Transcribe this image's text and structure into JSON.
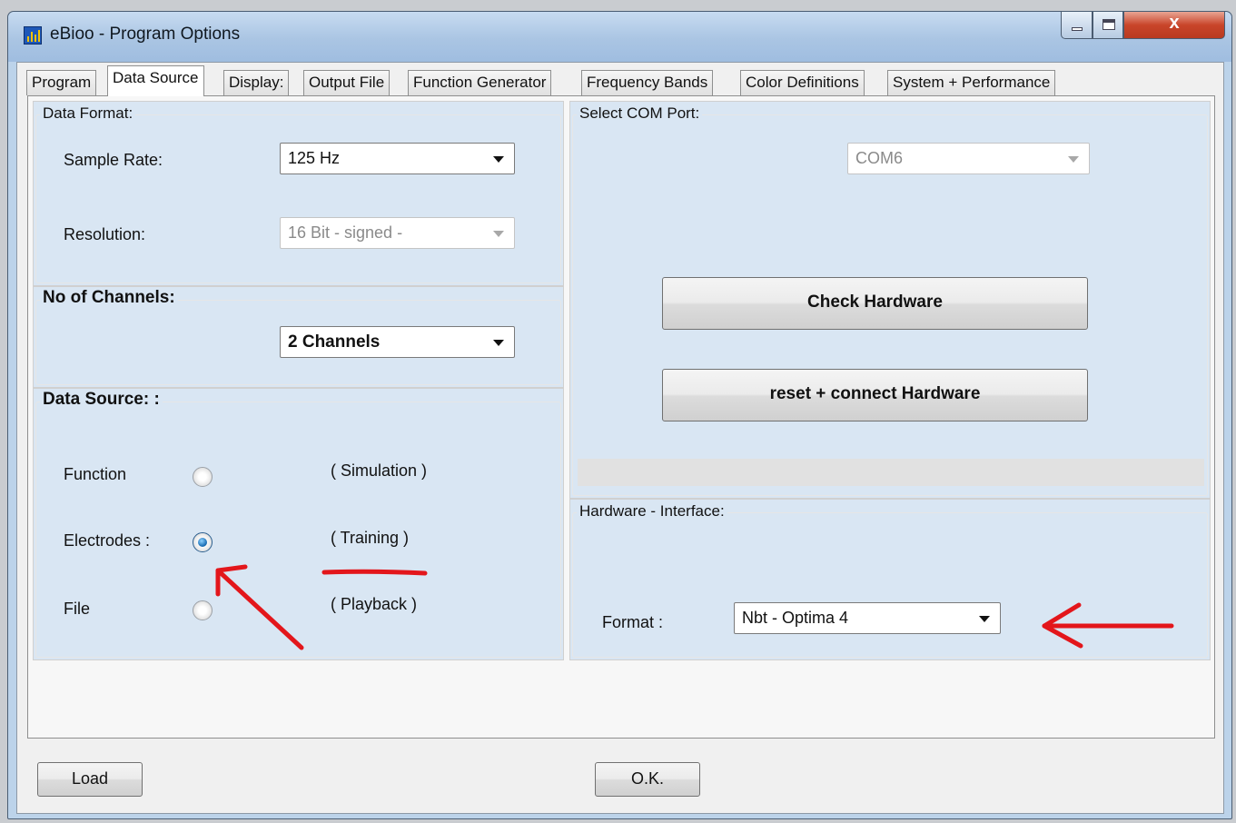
{
  "window": {
    "title": "eBioo - Program Options",
    "controls": {
      "minimize": "minimize-icon",
      "maximize": "maximize-icon",
      "close_glyph": "x"
    }
  },
  "tabs": [
    {
      "label": "Program"
    },
    {
      "label": "Data Source",
      "active": true
    },
    {
      "label": "Display:"
    },
    {
      "label": "Output File"
    },
    {
      "label": "Function Generator"
    },
    {
      "label": "Frequency Bands"
    },
    {
      "label": "Color Definitions"
    },
    {
      "label": "System + Performance"
    }
  ],
  "data_format": {
    "title": "Data Format:",
    "sample_rate_label": "Sample Rate:",
    "sample_rate_value": "125 Hz",
    "resolution_label": "Resolution:",
    "resolution_value": "16 Bit - signed -"
  },
  "channels": {
    "title": "No of Channels:",
    "value": "2 Channels"
  },
  "data_source": {
    "title": "Data Source: :",
    "options": [
      {
        "label": "Function",
        "hint": "( Simulation )",
        "checked": false
      },
      {
        "label": "Electrodes :",
        "hint": "( Training )",
        "checked": true
      },
      {
        "label": "File",
        "hint": "( Playback )",
        "checked": false
      }
    ]
  },
  "com_port": {
    "title": "Select COM Port:",
    "value": "COM6",
    "check_button": "Check Hardware",
    "reset_button": "reset + connect Hardware"
  },
  "hardware_interface": {
    "title": "Hardware - Interface:",
    "format_label": "Format :",
    "format_value": "Nbt - Optima 4"
  },
  "footer": {
    "load_button": "Load",
    "ok_button": "O.K."
  },
  "colors": {
    "group_bg": "#d9e6f3",
    "titlebar": "#aac5e3",
    "close_button": "#c9452a",
    "annotation": "#e3161b"
  }
}
